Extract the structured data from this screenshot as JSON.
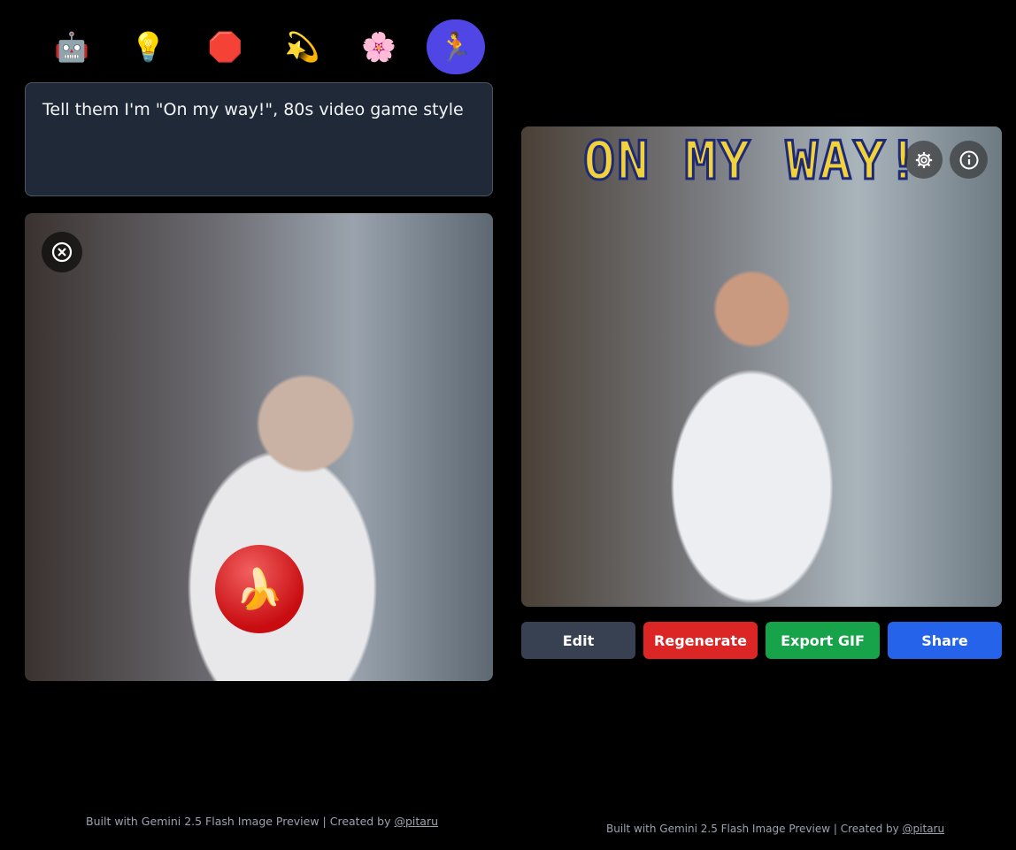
{
  "emoji_bar": [
    {
      "icon": "robot",
      "glyph": "🤖",
      "active": false
    },
    {
      "icon": "light-bulb",
      "glyph": "💡",
      "active": false
    },
    {
      "icon": "stop-sign",
      "glyph": "🛑",
      "active": false
    },
    {
      "icon": "dizzy-star",
      "glyph": "💫",
      "active": false
    },
    {
      "icon": "cherry-blossom",
      "glyph": "🌸",
      "active": false
    },
    {
      "icon": "running-person",
      "glyph": "🏃",
      "active": true
    }
  ],
  "prompt": {
    "value": "Tell them I'm \"On my way!\", 80s video game style"
  },
  "output": {
    "overlay_text": "ON MY WAY!"
  },
  "badge": {
    "glyph": "🍌"
  },
  "actions": {
    "edit": "Edit",
    "regenerate": "Regenerate",
    "export": "Export GIF",
    "share": "Share"
  },
  "footer": {
    "text": "Built with Gemini 2.5 Flash Image Preview | Created by ",
    "link": "@pitaru"
  },
  "colors": {
    "active": "#4f46e5",
    "edit": "#374151",
    "regenerate": "#dc2626",
    "export": "#16a34a",
    "share": "#2563eb"
  }
}
